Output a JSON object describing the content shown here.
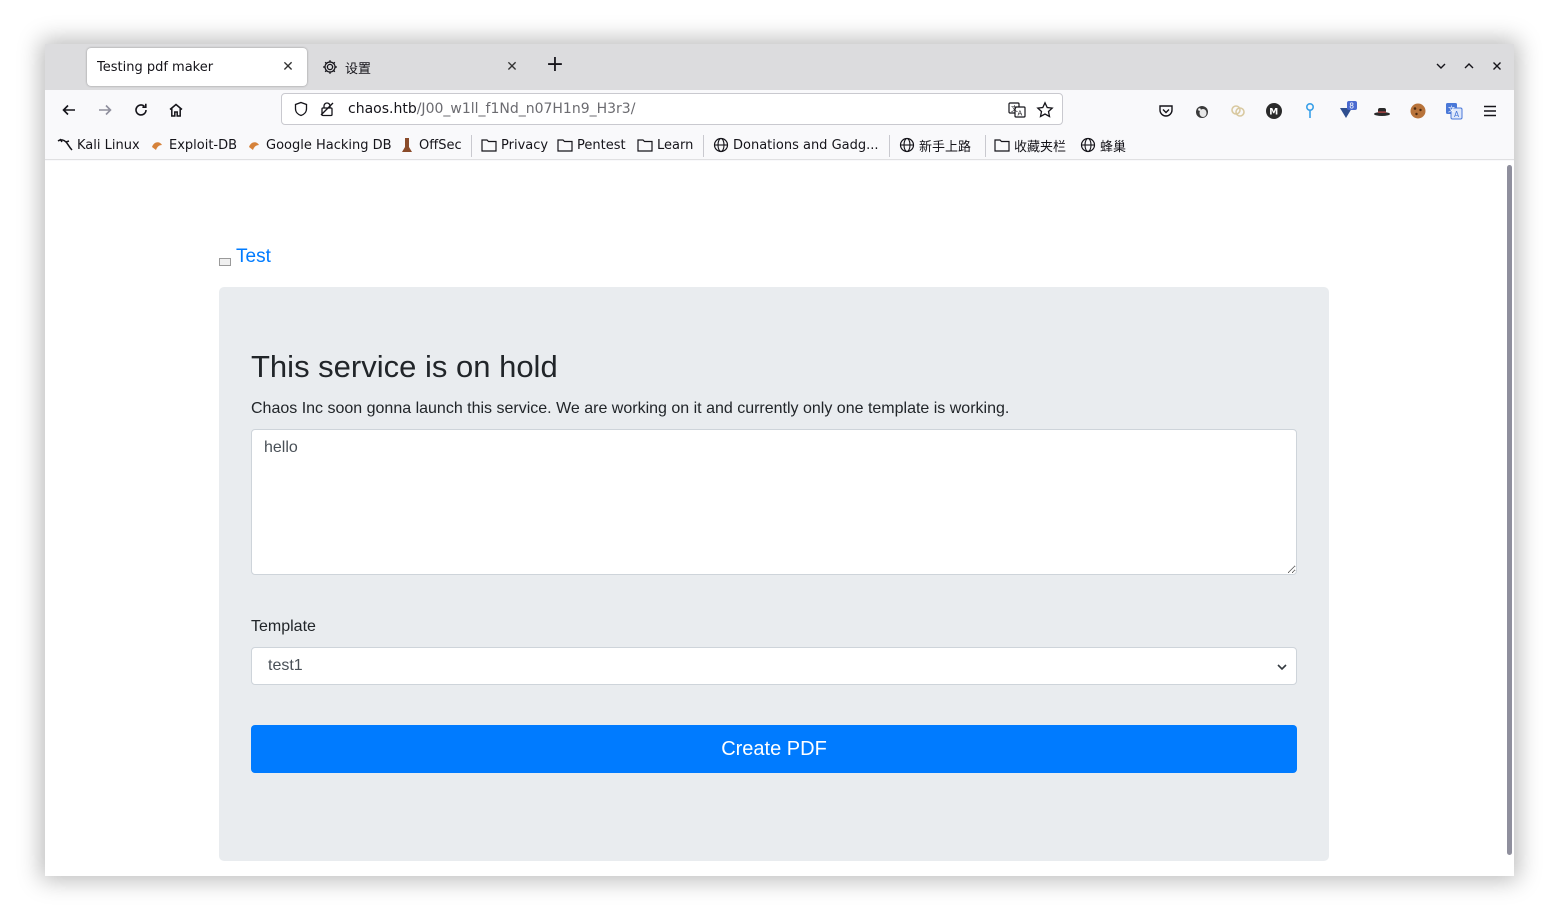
{
  "tabs": [
    {
      "title": "Testing pdf maker",
      "active": true
    },
    {
      "title": "设置",
      "active": false,
      "icon": "gear-icon"
    }
  ],
  "window_controls": [
    "chevron-down-icon",
    "chevron-up-icon",
    "close-icon"
  ],
  "nav": {
    "url_host": "chaos.htb",
    "url_path": "/J00_w1ll_f1Nd_n07H1n9_H3r3/"
  },
  "extensions": [
    "pocket-icon",
    "penguin-icon",
    "brain-icon",
    "wappalyzer-icon",
    "pin-icon",
    "badge-extension-icon",
    "hat-icon",
    "cookie-icon",
    "translate-icon",
    "menu-icon"
  ],
  "extension_badge": "8",
  "bookmarks": [
    {
      "label": "Kali Linux",
      "icon": "kali-dragon-icon"
    },
    {
      "label": "Exploit-DB",
      "icon": "exploitdb-icon"
    },
    {
      "label": "Google Hacking DB",
      "icon": "ghdb-icon"
    },
    {
      "label": "OffSec",
      "icon": "offsec-icon"
    },
    {
      "label": "Privacy",
      "icon": "folder-icon"
    },
    {
      "label": "Pentest",
      "icon": "folder-icon"
    },
    {
      "label": "Learn",
      "icon": "folder-icon"
    },
    {
      "label": "Donations and Gadg...",
      "icon": "globe-icon"
    },
    {
      "label": "新手上路",
      "icon": "globe-icon"
    },
    {
      "label": "收藏夹栏",
      "icon": "folder-icon"
    },
    {
      "label": "蜂巢",
      "icon": "globe-icon"
    }
  ],
  "page": {
    "link_text": "Test",
    "heading": "This service is on hold",
    "lead": "Chaos Inc soon gonna launch this service. We are working on it and currently only one template is working.",
    "textarea_value": "hello",
    "template_label": "Template",
    "template_selected": "test1",
    "button_label": "Create PDF"
  },
  "colors": {
    "accent": "#007bff",
    "jumbotron_bg": "#e9ecef",
    "tabstrip_bg": "#dcdcde"
  }
}
